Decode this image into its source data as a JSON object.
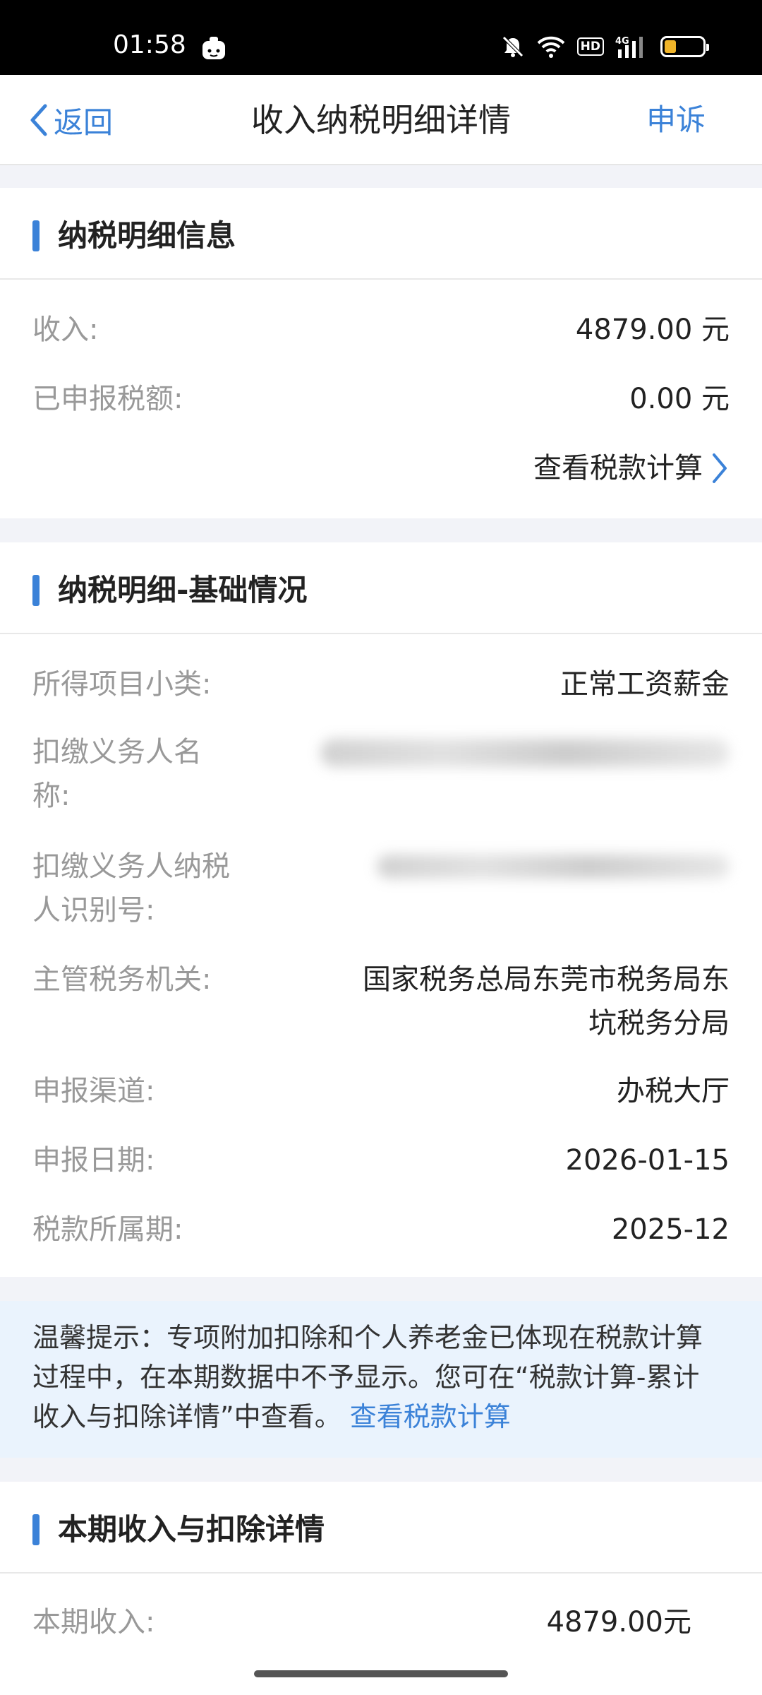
{
  "status_bar": {
    "time": "01:58",
    "icons": [
      "mute-icon",
      "wifi-icon",
      "hd-badge",
      "signal-4g-icon",
      "battery-icon"
    ],
    "hd_label": "HD",
    "network_label": "4G",
    "battery_level": 0.3
  },
  "nav": {
    "back_label": "返回",
    "title": "收入纳税明细详情",
    "complain_label": "申诉"
  },
  "tax_info": {
    "title": "纳税明细信息",
    "income_label": "收入:",
    "income_value": "4879.00 元",
    "declared_tax_label": "已申报税额:",
    "declared_tax_value": "0.00 元",
    "view_calc_label": "查看税款计算"
  },
  "basic_info": {
    "title": "纳税明细-基础情况",
    "subcategory_label": "所得项目小类:",
    "subcategory_value": "正常工资薪金",
    "withholder_name_label_1": "扣缴义务人名",
    "withholder_name_label_2": "称:",
    "withholder_id_label_1": "扣缴义务人纳税",
    "withholder_id_label_2": "人识别号:",
    "tax_authority_label": "主管税务机关:",
    "tax_authority_value_1": "国家税务总局东莞市税务局东",
    "tax_authority_value_2": "坑税务分局",
    "channel_label": "申报渠道:",
    "channel_value": "办税大厅",
    "date_label": "申报日期:",
    "date_value": "2026-01-15",
    "period_label": "税款所属期:",
    "period_value": "2025-12"
  },
  "tip": {
    "line1": "温馨提示：专项附加扣除和个人养老金已体现在税款计算",
    "line2": "过程中，在本期数据中不予显示。您可在“税款计算-累计",
    "line3": "收入与扣除详情”中查看。",
    "link_label": "查看税款计算"
  },
  "current_period": {
    "title": "本期收入与扣除详情",
    "income_label": "本期收入:",
    "income_value": "4879.00元"
  },
  "colors": {
    "accent": "#3b82d8",
    "page_bg": "#f2f3f8",
    "tip_bg": "#eaf3fd",
    "label_gray": "#999999"
  }
}
